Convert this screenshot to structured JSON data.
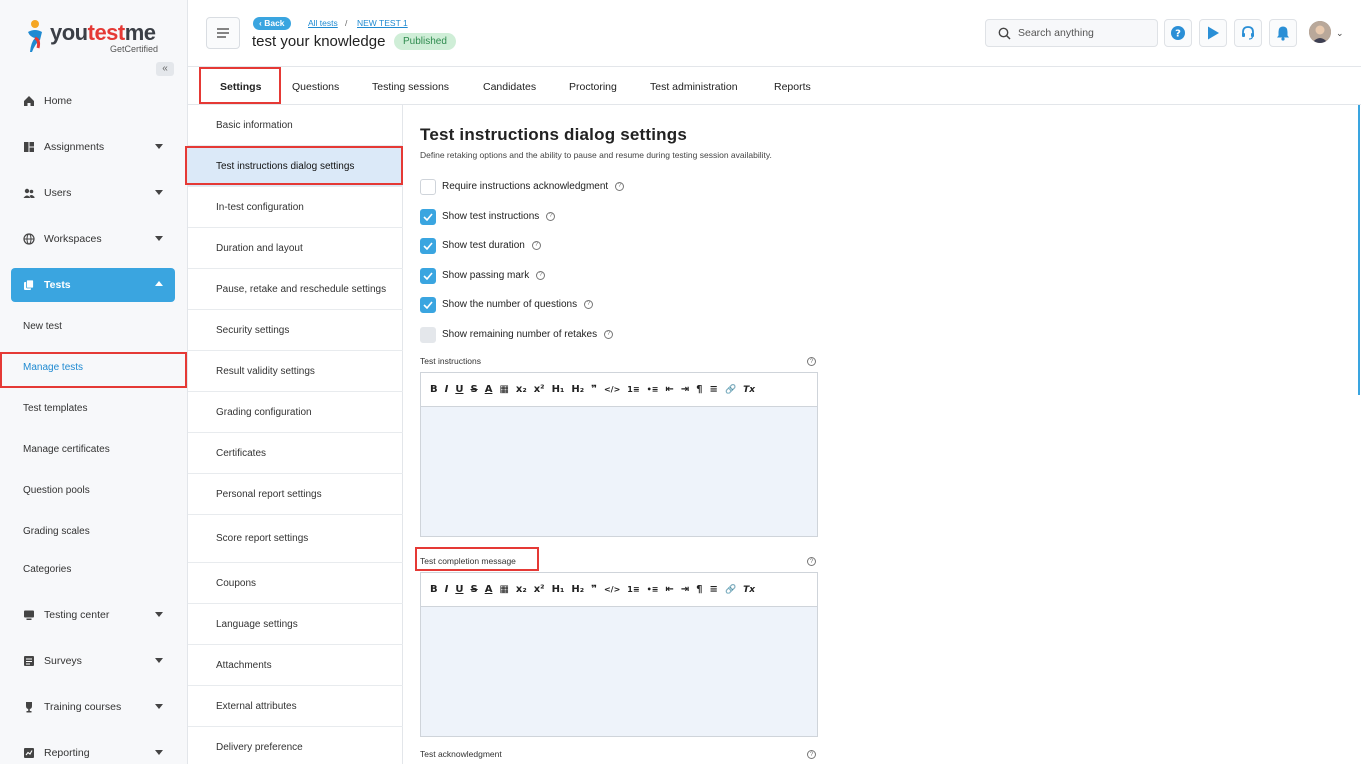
{
  "brand": {
    "name_part1": "you",
    "name_accent": "test",
    "name_part2": "me",
    "tagline": "GetCertified"
  },
  "sidebar": {
    "items": [
      {
        "label": "Home",
        "icon": "home-icon"
      },
      {
        "label": "Assignments",
        "icon": "assignments-icon"
      },
      {
        "label": "Users",
        "icon": "users-icon"
      },
      {
        "label": "Workspaces",
        "icon": "globe-icon"
      },
      {
        "label": "Tests",
        "icon": "tests-icon"
      }
    ],
    "tests_sub": [
      "New test",
      "Manage tests",
      "Test templates",
      "Manage certificates",
      "Question pools",
      "Grading scales",
      "Categories"
    ],
    "items_after": [
      {
        "label": "Testing center",
        "icon": "testing-center-icon"
      },
      {
        "label": "Surveys",
        "icon": "surveys-icon"
      },
      {
        "label": "Training courses",
        "icon": "trophy-icon"
      },
      {
        "label": "Reporting",
        "icon": "reporting-icon"
      }
    ]
  },
  "header": {
    "back_label": "Back",
    "breadcrumb": [
      "All tests",
      "/",
      "NEW TEST 1"
    ],
    "title": "test your knowledge",
    "status": "Published",
    "search_placeholder": "Search anything"
  },
  "tabs": [
    "Settings",
    "Questions",
    "Testing sessions",
    "Candidates",
    "Proctoring",
    "Test administration",
    "Reports"
  ],
  "settings_menu": [
    "Basic information",
    "Test instructions dialog settings",
    "In-test configuration",
    "Duration and layout",
    "Pause, retake and reschedule settings",
    "Security settings",
    "Result validity settings",
    "Grading configuration",
    "Certificates",
    "Personal report settings",
    "Score report settings",
    "Coupons",
    "Language settings",
    "Attachments",
    "External attributes",
    "Delivery preference"
  ],
  "main": {
    "title": "Test instructions dialog settings",
    "description": "Define retaking options and the ability to pause and resume during testing session availability.",
    "options": [
      {
        "label": "Require instructions acknowledgment",
        "checked": false
      },
      {
        "label": "Show test instructions",
        "checked": true
      },
      {
        "label": "Show test duration",
        "checked": true
      },
      {
        "label": "Show passing mark",
        "checked": true
      },
      {
        "label": "Show the number of questions",
        "checked": true
      },
      {
        "label": "Show remaining number of retakes",
        "checked": false
      }
    ],
    "fields": [
      "Test instructions",
      "Test completion message",
      "Test acknowledgment"
    ],
    "toolbar_buttons": [
      "B",
      "I",
      "U",
      "S",
      "A",
      "▦",
      "x₂",
      "x²",
      "H₁",
      "H₂",
      "❞",
      "</>",
      "1≡",
      "•≡",
      "⇤",
      "⇥",
      "¶",
      "≡",
      "🔗",
      "Tx"
    ]
  },
  "colors": {
    "accent": "#3aa5e0",
    "highlight": "#e53935",
    "published_bg": "#cfeed7",
    "published_text": "#2e8b4e",
    "selected_menu": "#dbe9f8"
  }
}
